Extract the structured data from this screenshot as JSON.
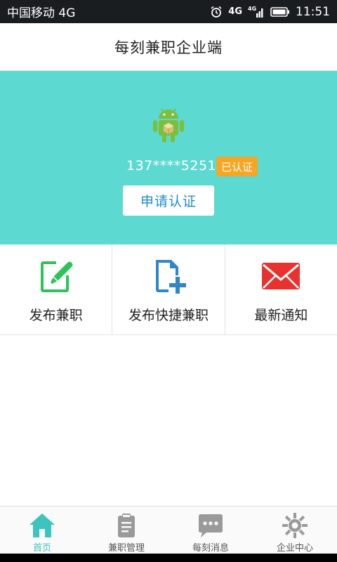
{
  "status_bar": {
    "carrier": "中国移动 4G",
    "network": "4G",
    "network2": "4G",
    "time": "11:51"
  },
  "header": {
    "title": "每刻兼职企业端"
  },
  "profile": {
    "phone": "137****5251",
    "badge": "已认证",
    "apply_button": "申请认证"
  },
  "actions": [
    {
      "label": "发布兼职",
      "icon": "edit-document-icon",
      "color": "#2ec25a"
    },
    {
      "label": "发布快捷兼职",
      "icon": "add-document-icon",
      "color": "#2f86c9"
    },
    {
      "label": "最新通知",
      "icon": "mail-icon",
      "color": "#e8322f"
    }
  ],
  "nav": [
    {
      "label": "首页",
      "icon": "home-icon",
      "active": true
    },
    {
      "label": "兼职管理",
      "icon": "clipboard-icon",
      "active": false
    },
    {
      "label": "每刻消息",
      "icon": "chat-icon",
      "active": false
    },
    {
      "label": "企业中心",
      "icon": "gear-icon",
      "active": false
    }
  ],
  "colors": {
    "accent": "#5cd9d0",
    "badge": "#f5a623",
    "nav_active": "#3cc4c0"
  }
}
